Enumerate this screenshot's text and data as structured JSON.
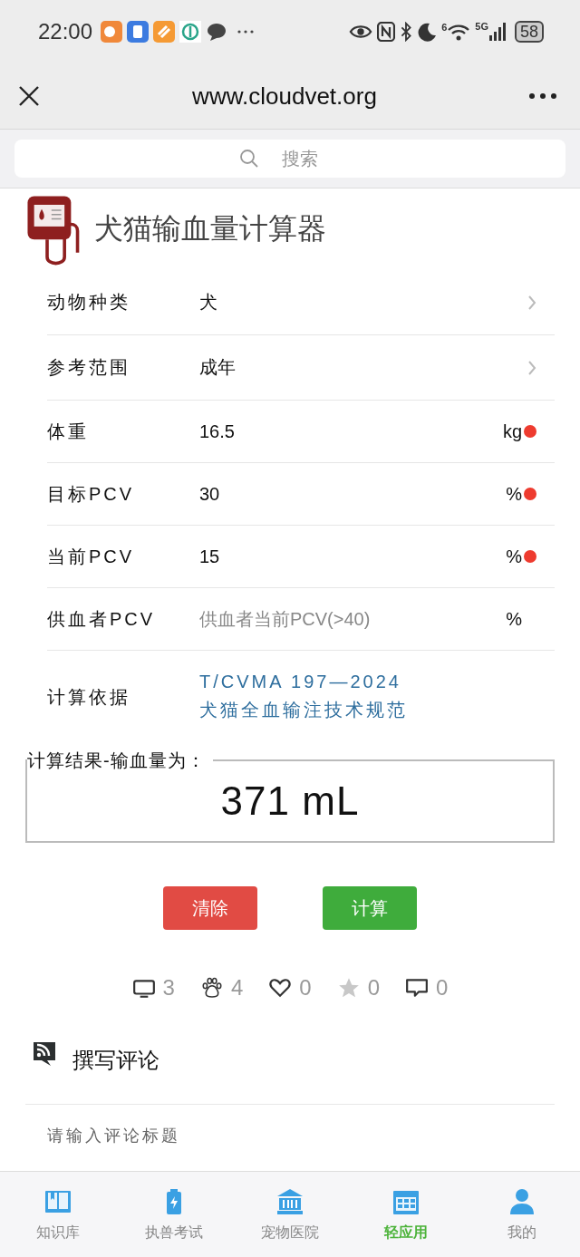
{
  "status_bar": {
    "time": "22:00",
    "wifi_badge": "6",
    "network": "5G",
    "battery": "58"
  },
  "header": {
    "title": "www.cloudvet.org"
  },
  "search": {
    "placeholder": "搜索"
  },
  "calculator": {
    "title": "犬猫输血量计算器",
    "fields": [
      {
        "kind": "select",
        "label": "动物种类",
        "value": "犬"
      },
      {
        "kind": "select",
        "label": "参考范围",
        "value": "成年"
      },
      {
        "kind": "input",
        "label": "体重",
        "value": "16.5",
        "unit": "kg",
        "required": true
      },
      {
        "kind": "input",
        "label": "目标PCV",
        "value": "30",
        "unit": "%",
        "required": true
      },
      {
        "kind": "input",
        "label": "当前PCV",
        "value": "15",
        "unit": "%",
        "required": true
      },
      {
        "kind": "input",
        "label": "供血者PCV",
        "placeholder": "供血者当前PCV(>40)",
        "unit": "%",
        "required": false
      },
      {
        "kind": "link",
        "label": "计算依据",
        "lines": [
          "T/CVMA 197—2024",
          "犬猫全血输注技术规范"
        ]
      }
    ],
    "result": {
      "legend": "计算结果-输血量为：",
      "value": "371 mL"
    },
    "buttons": [
      {
        "kind": "clear",
        "label": "清除"
      },
      {
        "kind": "calculate",
        "label": "计算"
      }
    ]
  },
  "stats": [
    {
      "kind": "views",
      "count": "3"
    },
    {
      "kind": "paw",
      "count": "4"
    },
    {
      "kind": "likes",
      "count": "0"
    },
    {
      "kind": "favorites",
      "count": "0"
    },
    {
      "kind": "comments",
      "count": "0"
    }
  ],
  "comment": {
    "title": "撰写评论",
    "placeholder": "请输入评论标题"
  },
  "nav": [
    {
      "kind": "book",
      "label": "知识库",
      "selected": false
    },
    {
      "kind": "exam",
      "label": "执兽考试",
      "selected": false
    },
    {
      "kind": "hospital",
      "label": "宠物医院",
      "selected": false
    },
    {
      "kind": "apps",
      "label": "轻应用",
      "selected": true
    },
    {
      "kind": "me",
      "label": "我的",
      "selected": false
    }
  ]
}
